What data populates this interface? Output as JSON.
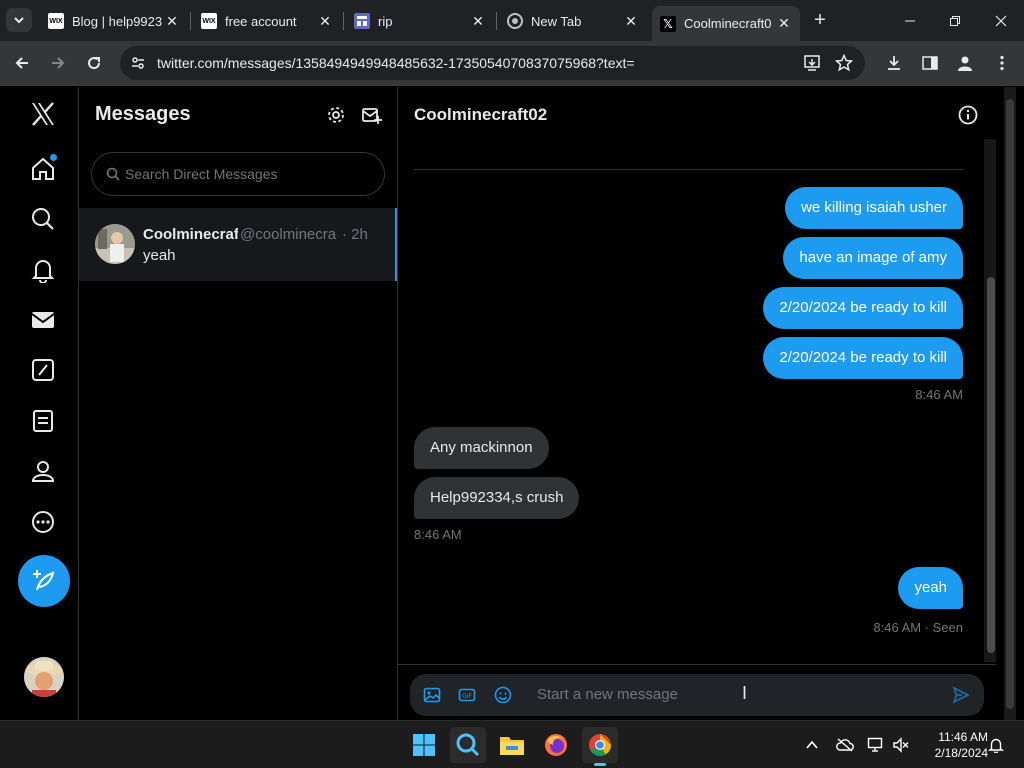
{
  "browser": {
    "tabs": [
      {
        "title": "Blog | help9923",
        "favicon": "wix-icon",
        "active": false
      },
      {
        "title": "free account",
        "favicon": "wix-icon",
        "active": false
      },
      {
        "title": "rip",
        "favicon": "forms-icon",
        "active": false
      },
      {
        "title": "New Tab",
        "favicon": "chrome-icon",
        "active": false
      },
      {
        "title": "Coolminecraft0",
        "favicon": "x-logo-icon",
        "active": true
      }
    ],
    "url": "twitter.com/messages/1358494949948485632-1735054070837075968?text="
  },
  "sidebar": {
    "brand": "X",
    "items": [
      "home-icon",
      "search-icon",
      "notifications-icon",
      "messages-icon",
      "grok-icon",
      "lists-icon",
      "profile-icon",
      "more-icon"
    ]
  },
  "messages_panel": {
    "title": "Messages",
    "search_placeholder": "Search Direct Messages",
    "conversations": [
      {
        "name": "Coolminecraft",
        "handle": "@coolminecra",
        "time": "· 2h",
        "preview": "yeah"
      }
    ]
  },
  "chat": {
    "title": "Coolminecraft02",
    "messages": [
      {
        "text": "we killing isaiah usher",
        "direction": "out"
      },
      {
        "text": "have an image of amy",
        "direction": "out"
      },
      {
        "text": "2/20/2024 be ready to kill",
        "direction": "out"
      },
      {
        "text": "2/20/2024 be ready to kill",
        "direction": "out"
      },
      {
        "text": "Any mackinnon",
        "direction": "in"
      },
      {
        "text": "Help992334,s crush",
        "direction": "in"
      },
      {
        "text": "yeah",
        "direction": "out"
      }
    ],
    "stamps": [
      "8:46 AM",
      "8:46 AM",
      "8:46 AM · Seen"
    ],
    "composer_placeholder": "Start a new message"
  },
  "taskbar": {
    "time": "11:46 AM",
    "date": "2/18/2024"
  },
  "colors": {
    "accent": "#1d9bf0",
    "incoming_bubble": "#2f3336",
    "background": "#000000"
  }
}
